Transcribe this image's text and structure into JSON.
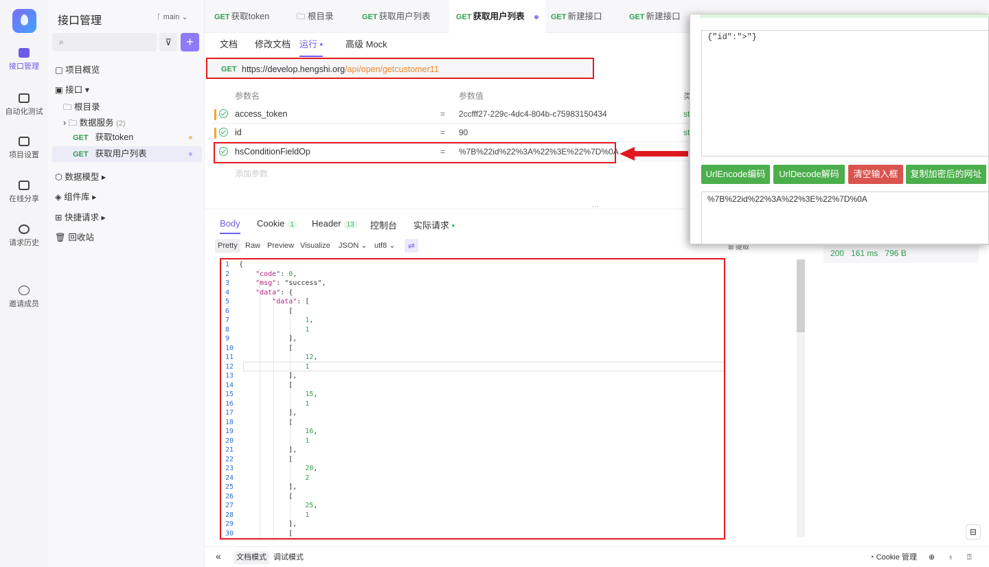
{
  "rail": {
    "items": [
      {
        "label": "接口管理"
      },
      {
        "label": "自动化测试"
      },
      {
        "label": "项目设置"
      },
      {
        "label": "在线分享"
      },
      {
        "label": "请求历史"
      },
      {
        "label": "邀请成员"
      }
    ]
  },
  "sidebar": {
    "title": "接口管理",
    "branch": "main",
    "tree": {
      "overview": "项目概览",
      "api": "接口",
      "root": "根目录",
      "data_service": "数据服务",
      "data_service_count": "(2)",
      "get_token": "获取token",
      "get_users": "获取用户列表",
      "data_model": "数据模型",
      "components": "组件库",
      "quick_request": "快捷请求",
      "recycle": "回收站"
    },
    "method_get": "GET"
  },
  "tabs": [
    {
      "method": "GET",
      "label": "获取token"
    },
    {
      "method": "",
      "label": "根目录"
    },
    {
      "method": "GET",
      "label": "获取用户列表"
    },
    {
      "method": "GET",
      "label": "获取用户列表"
    },
    {
      "method": "GET",
      "label": "新建接口"
    },
    {
      "method": "GET",
      "label": "新建接口"
    }
  ],
  "subtabs": [
    "文档",
    "修改文档",
    "运行",
    "高级 Mock"
  ],
  "request": {
    "method": "GET",
    "url_base": "https://develop.hengshi.org",
    "url_path": "/api/open/getcustomer11"
  },
  "params": {
    "header_name": "参数名",
    "header_value": "参数值",
    "header_type": "类",
    "rows": [
      {
        "name": "access_token",
        "eq": "=",
        "value": "2ccfff27-229c-4dc4-804b-c75983150434",
        "type": "st"
      },
      {
        "name": "id",
        "eq": "=",
        "value": "90",
        "type": "st"
      },
      {
        "name": "hsConditionFieldOp",
        "eq": "=",
        "value": "%7B%22id%22%3A%22%3E%22%7D%0A",
        "type": ""
      }
    ],
    "add_placeholder": "添加参数"
  },
  "response": {
    "tabs": [
      "Body",
      "Cookie",
      "Header",
      "控制台",
      "实际请求"
    ],
    "cookie_count": "1",
    "header_count": "13",
    "formats": [
      "Pretty",
      "Raw",
      "Preview",
      "Visualize",
      "JSON",
      "utf8"
    ],
    "extract": "提取",
    "status": "200",
    "time": "161 ms",
    "size": "796 B"
  },
  "code_lines": [
    "{",
    "    \"code\": 0,",
    "    \"msg\": \"success\",",
    "    \"data\": {",
    "        \"data\": [",
    "            [",
    "                1,",
    "                1",
    "            ],",
    "            [",
    "                12,",
    "                1",
    "            ],",
    "            [",
    "                15,",
    "                1",
    "            ],",
    "            [",
    "                16,",
    "                1",
    "            ],",
    "            [",
    "                20,",
    "                2",
    "            ],",
    "            [",
    "                25,",
    "                1",
    "            ],",
    "            ["
  ],
  "bottom": {
    "doc_mode": "文档模式",
    "debug_mode": "调试模式",
    "cookie_mgmt": "Cookie 管理"
  },
  "popup": {
    "input_text": "{\"id\":\">\"}",
    "btn_encode": "UrlEncode编码",
    "btn_decode": "UrlDecode解码",
    "btn_clear": "清空输入框",
    "btn_copy": "复制加密后的网址",
    "output_text": "%7B%22id%22%3A%22%3E%22%7D%0A",
    "colors": {
      "green": "#4cae4c",
      "red": "#d9534f"
    }
  },
  "colors": {
    "accent": "#6c5ce7",
    "get_green": "#2e9e4f",
    "highlight_red": "#e0191f",
    "url_path_orange": "#f0882a"
  }
}
